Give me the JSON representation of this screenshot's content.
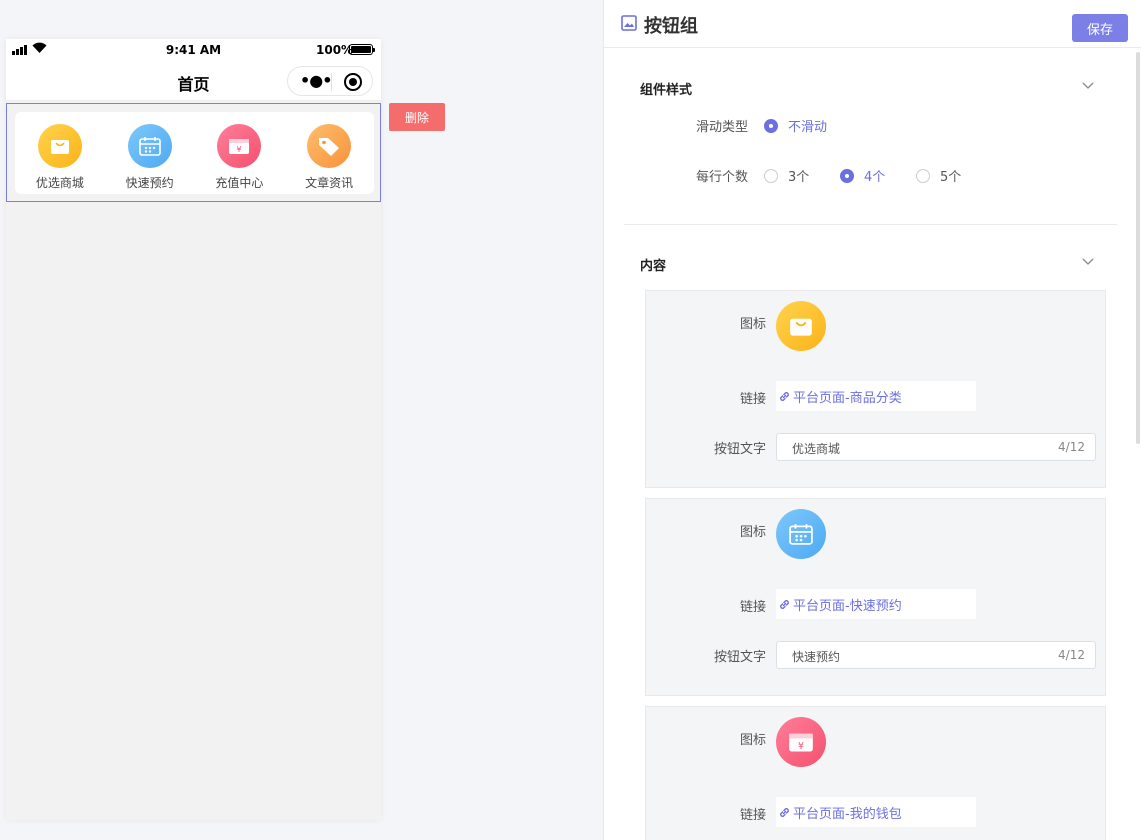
{
  "phone": {
    "status_time": "9:41 AM",
    "battery_percent": "100%",
    "nav_title": "首页",
    "delete_label": "删除",
    "buttons": [
      {
        "label": "优选商城",
        "icon": "shopping-bag-icon",
        "color": "#fbb31a"
      },
      {
        "label": "快速预约",
        "icon": "calendar-icon",
        "color": "#4ea9f2"
      },
      {
        "label": "充值中心",
        "icon": "wallet-icon",
        "color": "#f4516c"
      },
      {
        "label": "文章资讯",
        "icon": "tag-icon",
        "color": "#f7923b"
      }
    ]
  },
  "editor": {
    "title": "按钮组",
    "save_label": "保存",
    "style_section": {
      "title": "组件样式",
      "scroll_type_label": "滑动类型",
      "scroll_type_value": "不滑动",
      "per_row_label": "每行个数",
      "per_row_options": [
        "3个",
        "4个",
        "5个"
      ],
      "per_row_selected": "4个"
    },
    "content_section": {
      "title": "内容",
      "icon_label": "图标",
      "link_label": "链接",
      "text_label": "按钮文字",
      "items": [
        {
          "link": "平台页面-商品分类",
          "text": "优选商城",
          "count": "4/12"
        },
        {
          "link": "平台页面-快速预约",
          "text": "快速预约",
          "count": "4/12"
        },
        {
          "link": "平台页面-我的钱包"
        }
      ]
    }
  },
  "colors": {
    "accent": "#7b7fe6",
    "danger": "#f56c6c"
  }
}
